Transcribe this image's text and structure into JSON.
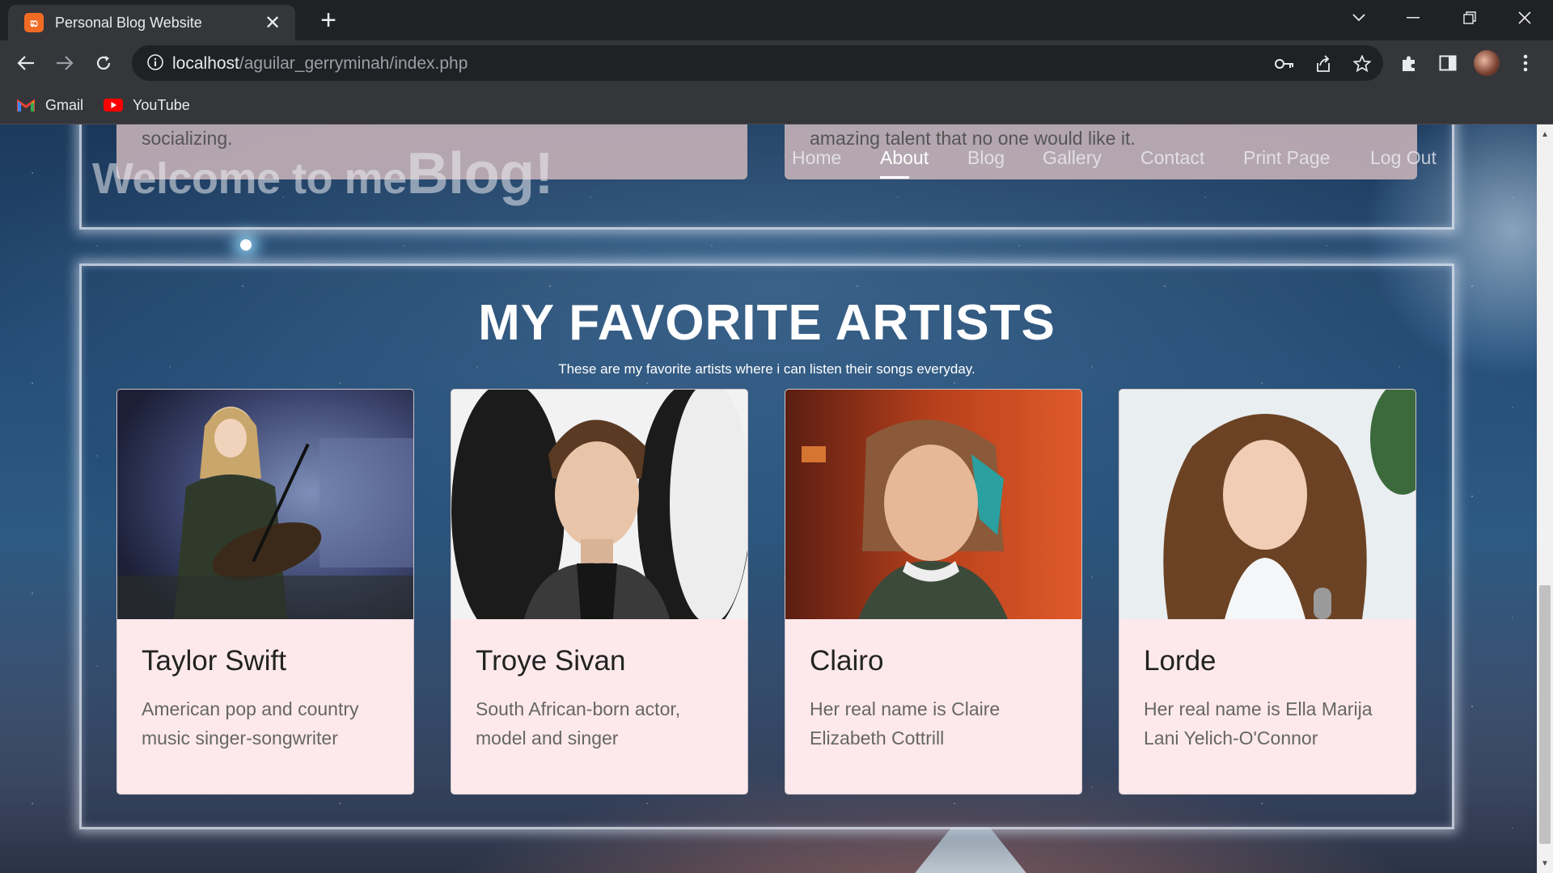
{
  "browser": {
    "tab_title": "Personal Blog Website",
    "tab_favicon": "xampp-icon",
    "url_host": "localhost",
    "url_path": "/aguilar_gerryminah/index.php",
    "bookmarks": [
      {
        "label": "Gmail",
        "icon": "gmail-icon"
      },
      {
        "label": "YouTube",
        "icon": "youtube-icon"
      }
    ]
  },
  "header": {
    "left_snippet": "socializing.",
    "right_snippet": "amazing talent that no one would like it.",
    "welcome_prefix": "Welcome to me",
    "welcome_big": "Blog!",
    "nav": [
      {
        "label": "Home",
        "active": false
      },
      {
        "label": "About",
        "active": true
      },
      {
        "label": "Blog",
        "active": false
      },
      {
        "label": "Gallery",
        "active": false
      },
      {
        "label": "Contact",
        "active": false
      },
      {
        "label": "Print Page",
        "active": false
      },
      {
        "label": "Log Out",
        "active": false
      }
    ]
  },
  "artists_section": {
    "title": "MY FAVORITE ARTISTS",
    "subtitle": "These are my favorite artists where i can listen their songs everyday.",
    "artists": [
      {
        "name": "Taylor Swift",
        "description": "American pop and country music singer-songwriter"
      },
      {
        "name": "Troye Sivan",
        "description": "South African-born actor, model and singer"
      },
      {
        "name": "Clairo",
        "description": "Her real name is Claire Elizabeth Cottrill"
      },
      {
        "name": "Lorde",
        "description": "Her real name is Ella Marija Lani Yelich-O'Connor"
      }
    ]
  },
  "colors": {
    "card_background": "#fde9ec",
    "header_card": "#c8b4b9",
    "chrome_dark": "#202124",
    "chrome_toolbar": "#35363a"
  }
}
